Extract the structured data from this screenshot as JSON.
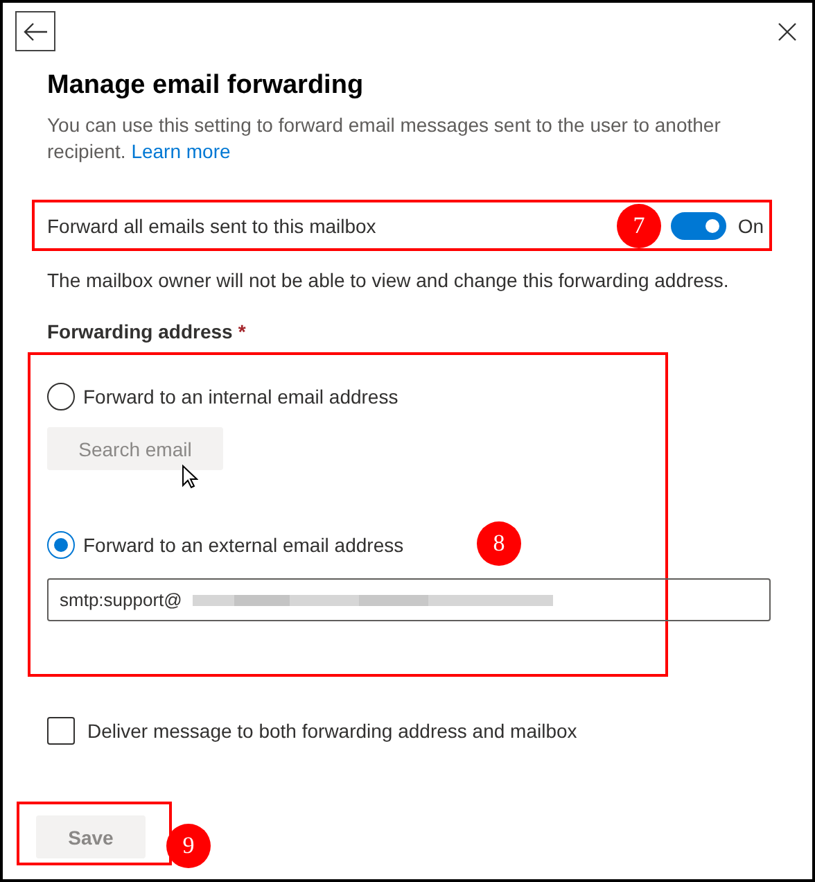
{
  "title": "Manage email forwarding",
  "description": "You can use this setting to forward email messages sent to the user to another recipient.",
  "learn_more_link": "Learn more",
  "toggle": {
    "label": "Forward all emails sent to this mailbox",
    "on": true,
    "state_text": "On",
    "highlighted": true,
    "callout": "7"
  },
  "toggle_note": "The mailbox owner will not be able to view and change this forwarding address.",
  "forwarding_address": {
    "label": "Forwarding address",
    "required_mark": "*",
    "highlighted": true
  },
  "options": [
    {
      "label": "Forward to an internal email address",
      "selected": false
    },
    {
      "label": "Forward to an external email address",
      "selected": true,
      "callout": "8"
    }
  ],
  "search_button": {
    "label": "Search email",
    "disabled": true
  },
  "address_field": {
    "value": "smtp:support@"
  },
  "deliver_both": {
    "label": "Deliver message to both forwarding address and mailbox",
    "checked": false
  },
  "save_button": {
    "label": "Save",
    "disabled": true,
    "highlighted": true,
    "callout": "9"
  }
}
